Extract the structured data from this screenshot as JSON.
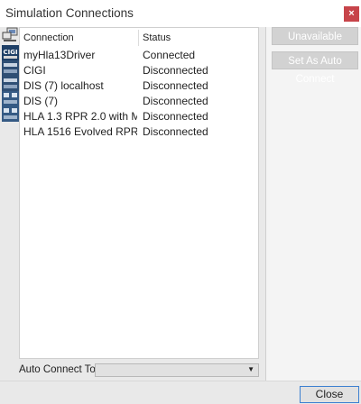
{
  "window": {
    "title": "Simulation Connections",
    "close_glyph": "×"
  },
  "table": {
    "columns": [
      "Connection",
      "Status"
    ],
    "rows": [
      {
        "connection": "myHla13Driver",
        "status": "Connected",
        "icon": "network-pc-icon"
      },
      {
        "connection": "CIGI",
        "status": "Disconnected",
        "icon": "cigi-icon"
      },
      {
        "connection": "DIS (7) localhost",
        "status": "Disconnected",
        "icon": "dis-icon"
      },
      {
        "connection": "DIS (7)",
        "status": "Disconnected",
        "icon": "dis-icon"
      },
      {
        "connection": "HLA 1.3 RPR 2.0 with M...",
        "status": "Disconnected",
        "icon": "hla-icon"
      },
      {
        "connection": "HLA 1516 Evolved RPR ...",
        "status": "Disconnected",
        "icon": "hla-icon"
      }
    ]
  },
  "auto_connect": {
    "label": "Auto Connect To:",
    "value": ""
  },
  "side_buttons": {
    "unavailable": "Unavailable",
    "set_auto": "Set As Auto Connect"
  },
  "footer": {
    "close": "Close"
  },
  "colors": {
    "accent": "#3c7fd0",
    "close_red": "#c7444a"
  }
}
